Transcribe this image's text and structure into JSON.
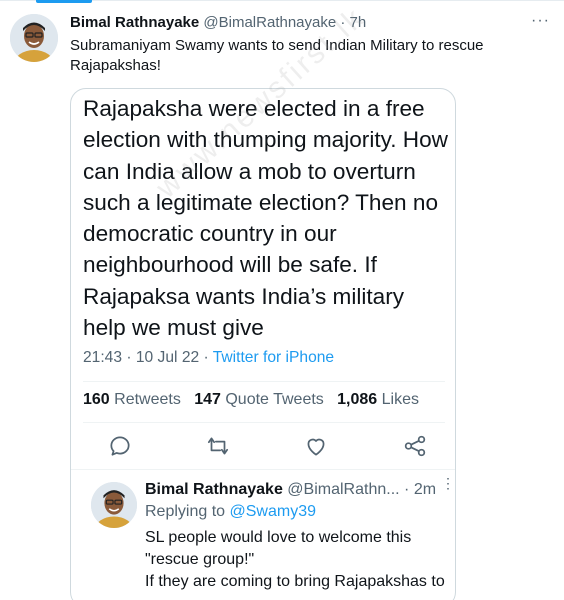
{
  "tweet": {
    "author_name": "Bimal Rathnayake",
    "author_handle": "@BimalRathnayake",
    "separator": "·",
    "time": "7h",
    "text": "Subramaniyam Swamy wants to send Indian Military to rescue Rajapakshas!",
    "more_icon": "ellipsis-icon"
  },
  "quoted": {
    "text": "Rajapaksha were elected in a free election with thumping majority. How can India allow a mob to overturn such a  legitimate election? Then no democratic country in our neighbourhood will be safe. If Rajapaksa wants India’s military help we must give",
    "timestamp": "21:43 · 10 Jul 22",
    "meta_separator": " · ",
    "source": "Twitter for iPhone",
    "retweets_count": "160",
    "retweets_label": "Retweets",
    "quotes_count": "147",
    "quotes_label": "Quote Tweets",
    "likes_count": "1,086",
    "likes_label": "Likes",
    "actions": [
      "reply-icon",
      "retweet-icon",
      "like-icon",
      "share-icon"
    ]
  },
  "reply": {
    "author_name": "Bimal Rathnayake",
    "author_handle": "@BimalRathn...",
    "separator": "·",
    "time": "2m",
    "replying_label": "Replying to",
    "replying_to": "@Swamy39",
    "text_line1": "SL people would love to welcome this \"rescue group!\"",
    "text_line2": "If they are coming to bring Rajapakshas to"
  },
  "watermark": "www.newsfirst.lk",
  "colors": {
    "accent": "#1d9bf0",
    "text_primary": "#0f1419",
    "text_secondary": "#536471",
    "border": "#cfd9de"
  }
}
